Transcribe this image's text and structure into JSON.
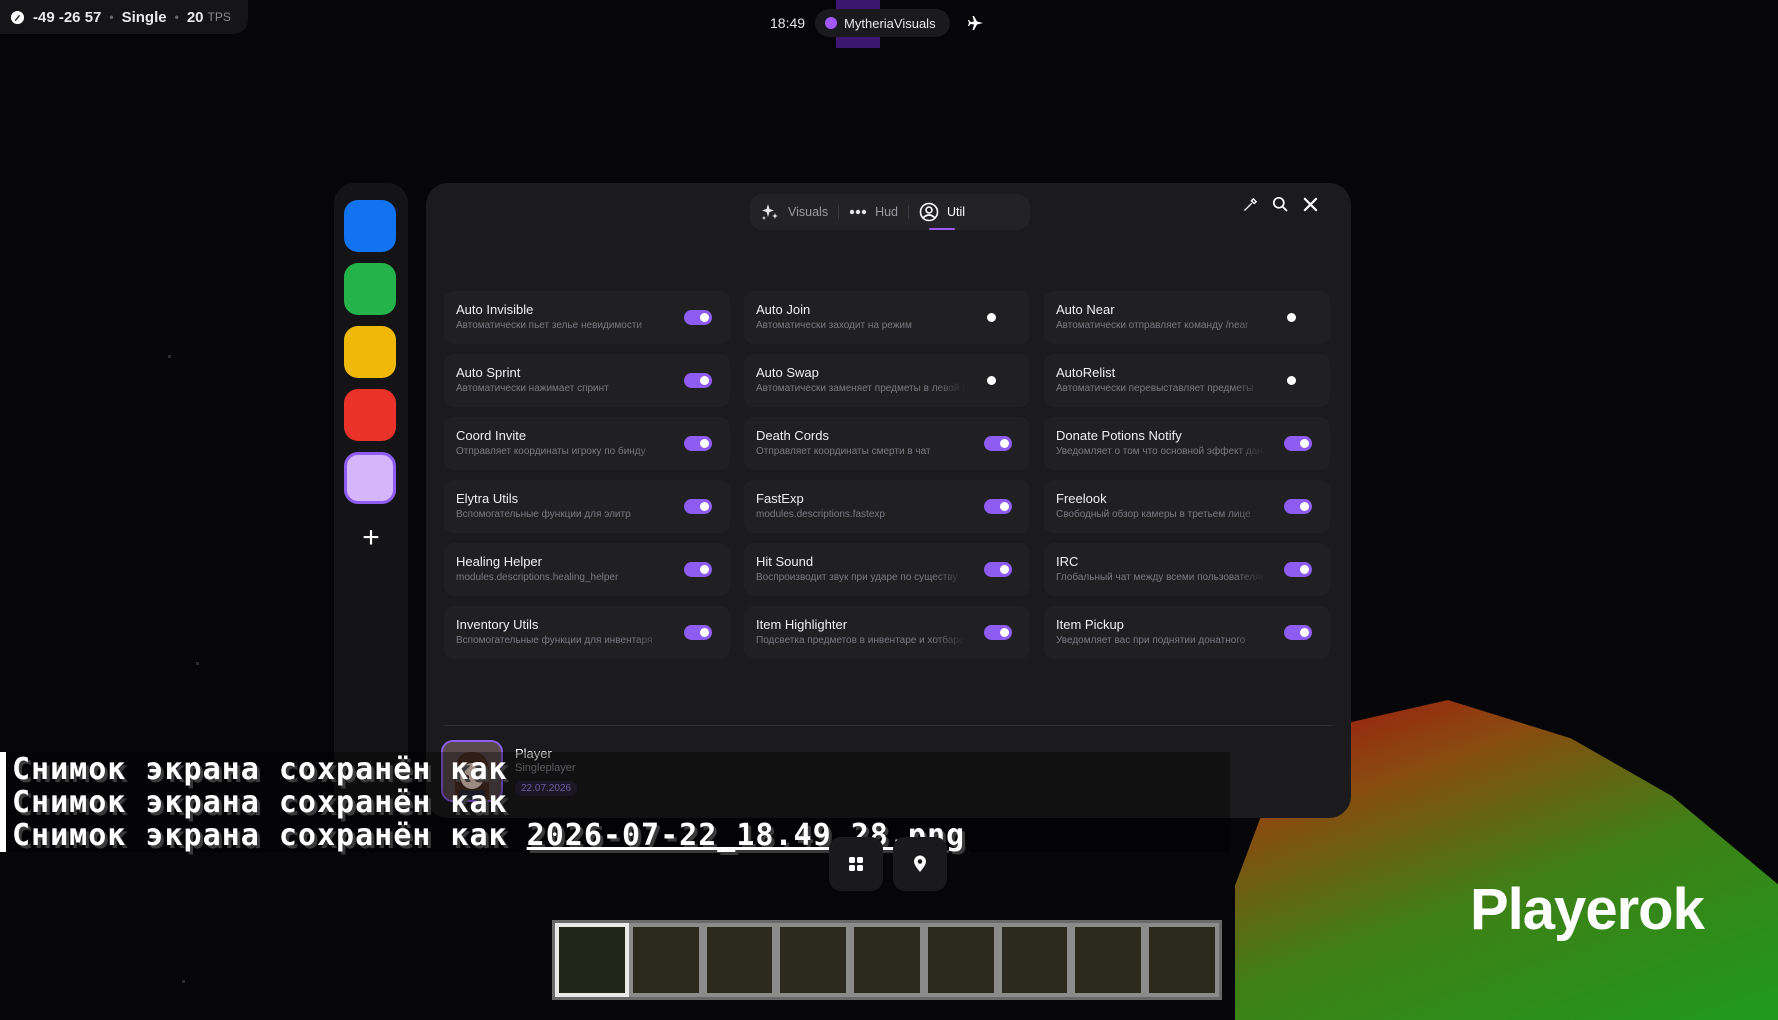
{
  "hud": {
    "coords": "-49 -26 57",
    "mode": "Single",
    "tps_value": "20",
    "tps_label": "TPS",
    "time": "18:49",
    "brand": "MytheriaVisuals"
  },
  "sidebar": {
    "themes": [
      {
        "name": "blue",
        "color": "#1273f0"
      },
      {
        "name": "green",
        "color": "#24b34a"
      },
      {
        "name": "yellow",
        "color": "#f0b808"
      },
      {
        "name": "red",
        "color": "#e8322a"
      },
      {
        "name": "lavender",
        "color": "#d7b5fb"
      }
    ],
    "add_label": "+"
  },
  "tabs": [
    {
      "label": "Visuals",
      "icon": "sparkles-icon",
      "active": false
    },
    {
      "label": "Hud",
      "icon": "dots-icon",
      "active": false
    },
    {
      "label": "Util",
      "icon": "user-circle-icon",
      "active": true
    }
  ],
  "header_icons": [
    "pipette-icon",
    "search-icon",
    "close-icon"
  ],
  "modules": [
    {
      "name": "Auto Invisible",
      "desc": "Автоматически пьет зелье невидимости",
      "on": true
    },
    {
      "name": "Auto Join",
      "desc": "Автоматически заходит на режим",
      "on": false
    },
    {
      "name": "Auto Near",
      "desc": "Автоматически отправляет команду /near",
      "on": false
    },
    {
      "name": "Auto Sprint",
      "desc": "Автоматически нажимает спринт",
      "on": true
    },
    {
      "name": "Auto Swap",
      "desc": "Автоматически заменяет предметы в левой руке",
      "on": false
    },
    {
      "name": "AutoRelist",
      "desc": "Автоматически перевыставляет предметы",
      "on": false
    },
    {
      "name": "Coord Invite",
      "desc": "Отправляет координаты игроку по бинду",
      "on": true
    },
    {
      "name": "Death Cords",
      "desc": "Отправляет координаты смерти в чат",
      "on": true
    },
    {
      "name": "Donate Potions Notify",
      "desc": "Уведомляет о том что основной эффект дана",
      "on": true
    },
    {
      "name": "Elytra Utils",
      "desc": "Вспомогательные функции для элитр",
      "on": true
    },
    {
      "name": "FastExp",
      "desc": "modules.descriptions.fastexp",
      "on": true
    },
    {
      "name": "Freelook",
      "desc": "Свободный обзор камеры в третьем лице",
      "on": true
    },
    {
      "name": "Healing Helper",
      "desc": "modules.descriptions.healing_helper",
      "on": true
    },
    {
      "name": "Hit Sound",
      "desc": "Воспроизводит звук при ударе по существу",
      "on": true
    },
    {
      "name": "IRC",
      "desc": "Глобальный чат между всеми пользователями",
      "on": true
    },
    {
      "name": "Inventory Utils",
      "desc": "Вспомогательные функции для инвентаря",
      "on": true
    },
    {
      "name": "Item Highlighter",
      "desc": "Подсветка предметов в инвентаре и хотбаре",
      "on": true
    },
    {
      "name": "Item Pickup",
      "desc": "Уведомляет вас при поднятии донатного",
      "on": true
    }
  ],
  "profile": {
    "name": "Player",
    "mode": "Singleplayer",
    "date": "22.07.2026"
  },
  "chat": {
    "line1": "Снимок экрана сохранён как",
    "line2": "Снимок экрана сохранён как",
    "line3_prefix": "Снимок экрана сохранён как ",
    "line3_file": "2026-07-22_18.49.28.png"
  },
  "bottom_buttons": [
    "grid-icon",
    "map-pin-icon"
  ],
  "watermark": "Playerok"
}
